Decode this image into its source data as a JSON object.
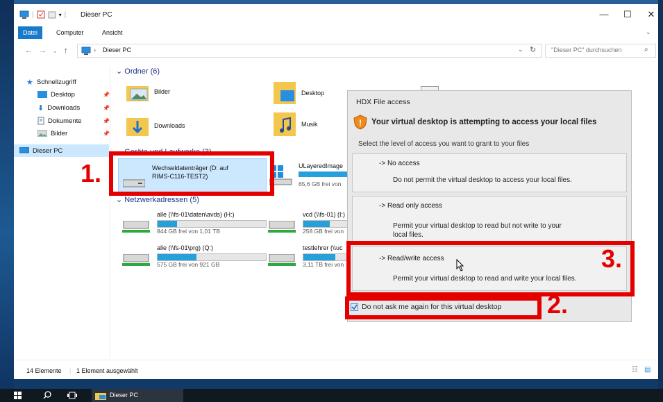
{
  "window": {
    "title": "Dieser PC",
    "minimize": "—",
    "maximize": "☐",
    "close": "✕"
  },
  "ribbon": {
    "tabs": [
      "Datei",
      "Computer",
      "Ansicht"
    ]
  },
  "address": {
    "path": "Dieser PC",
    "search_placeholder": "\"Dieser PC\" durchsuchen"
  },
  "sidebar": {
    "quick_access": "Schnellzugriff",
    "items": [
      "Desktop",
      "Downloads",
      "Dokumente",
      "Bilder"
    ],
    "this_pc": "Dieser PC"
  },
  "groups": {
    "folders": "Ordner (6)",
    "devices": "Geräte und Laufwerke (3)",
    "network": "Netzwerkadressen (5)"
  },
  "folders": [
    "Bilder",
    "Desktop",
    "Downloads",
    "Musik"
  ],
  "devices": [
    {
      "name": "Wechseldatenträger (D: auf",
      "name2": "RIMS-C116-TEST2)"
    },
    {
      "name": "ULayeredImage",
      "free": "65,6 GB frei von"
    }
  ],
  "network": [
    {
      "name": "alle (\\\\fs-01\\daten\\avds) (H:)",
      "free": "844 GB frei von 1,01 TB",
      "used_fraction": 0.18
    },
    {
      "name": "vcd (\\\\fs-01) (I:)",
      "free": "258 GB frei von",
      "used_fraction": 0.5
    },
    {
      "name": "alle (\\\\fs-01\\prg) (Q:)",
      "free": "575 GB frei von 921 GB",
      "used_fraction": 0.36
    },
    {
      "name": "testlehrer (\\\\uc",
      "free": "3,11 TB frei von",
      "used_fraction": 0.3
    }
  ],
  "status": {
    "count": "14 Elemente",
    "selected": "1 Element ausgewählt"
  },
  "taskbar": {
    "app": "Dieser PC"
  },
  "dialog": {
    "title": "HDX File access",
    "heading": "Your virtual desktop is attempting to access your local files",
    "subtitle": "Select the level of access  you want to grant to your files",
    "options": [
      {
        "label": "-> No access",
        "desc": "Do not permit the virtual desktop to access your local files."
      },
      {
        "label": "-> Read only access",
        "desc": "Permit your virtual desktop to read but not write to your",
        "desc2": "local files."
      },
      {
        "label": "-> Read/write access",
        "desc": "Permit your virtual desktop to read and write your local files."
      }
    ],
    "checkbox": "Do not ask me again for this virtual desktop",
    "checkbox_checked": true
  },
  "callouts": [
    "1.",
    "2.",
    "3."
  ],
  "colors": {
    "accent": "#1979ca",
    "highlight": "#e50000",
    "selection": "#cce8ff"
  }
}
